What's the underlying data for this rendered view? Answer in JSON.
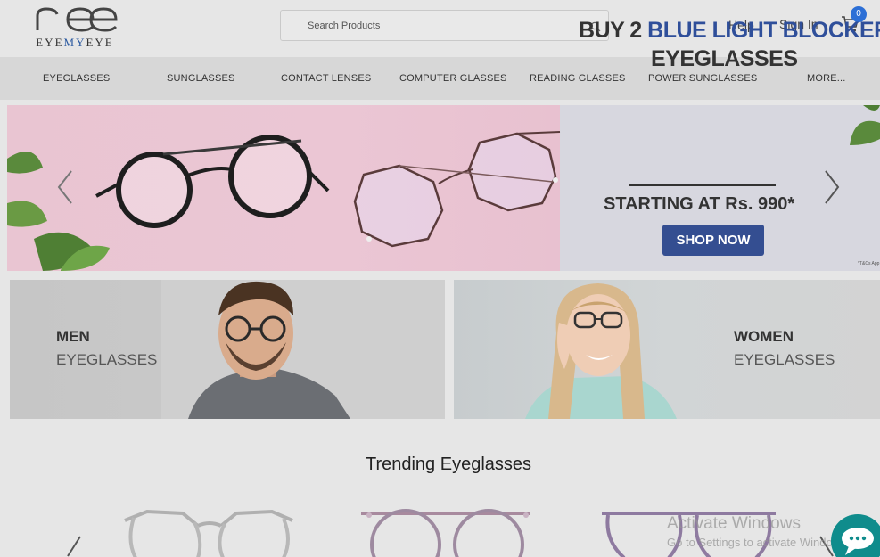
{
  "header": {
    "logo": {
      "mark": "ee",
      "word_left": "EYE",
      "word_mid": "MY",
      "word_right": "EYE"
    },
    "search": {
      "placeholder": "Search Products"
    },
    "help_label": "Help",
    "signin_label": "Sign In",
    "cart_count": "0"
  },
  "nav": {
    "items": [
      "EYEGLASSES",
      "SUNGLASSES",
      "CONTACT LENSES",
      "COMPUTER GLASSES",
      "READING GLASSES",
      "POWER SUNGLASSES",
      "MORE..."
    ]
  },
  "banner": {
    "line1_a": "BUY 2 ",
    "line1_b": "BLUE LIGHT BLOCKER",
    "line2": "EYEGLASSES",
    "line3": "STARTING AT Rs. 990*",
    "cta": "SHOP NOW",
    "tnc": "*T&Cs App"
  },
  "categories": {
    "men": {
      "title": "MEN",
      "subtitle": "EYEGLASSES"
    },
    "women": {
      "title": "WOMEN",
      "subtitle": "EYEGLASSES"
    }
  },
  "trending": {
    "title": "Trending Eyeglasses"
  },
  "watermark": {
    "line1": "Activate Windows",
    "line2": "Go to Settings to activate Windows."
  },
  "colors": {
    "accent": "#2f4f9a",
    "cta_bg": "#344e91",
    "badge": "#2c6fd6",
    "chat": "#0f8c8c"
  },
  "icons": {
    "search": "search-icon",
    "cart": "cart-icon",
    "chat": "chat-icon",
    "prev": "chevron-left-icon",
    "next": "chevron-right-icon"
  }
}
